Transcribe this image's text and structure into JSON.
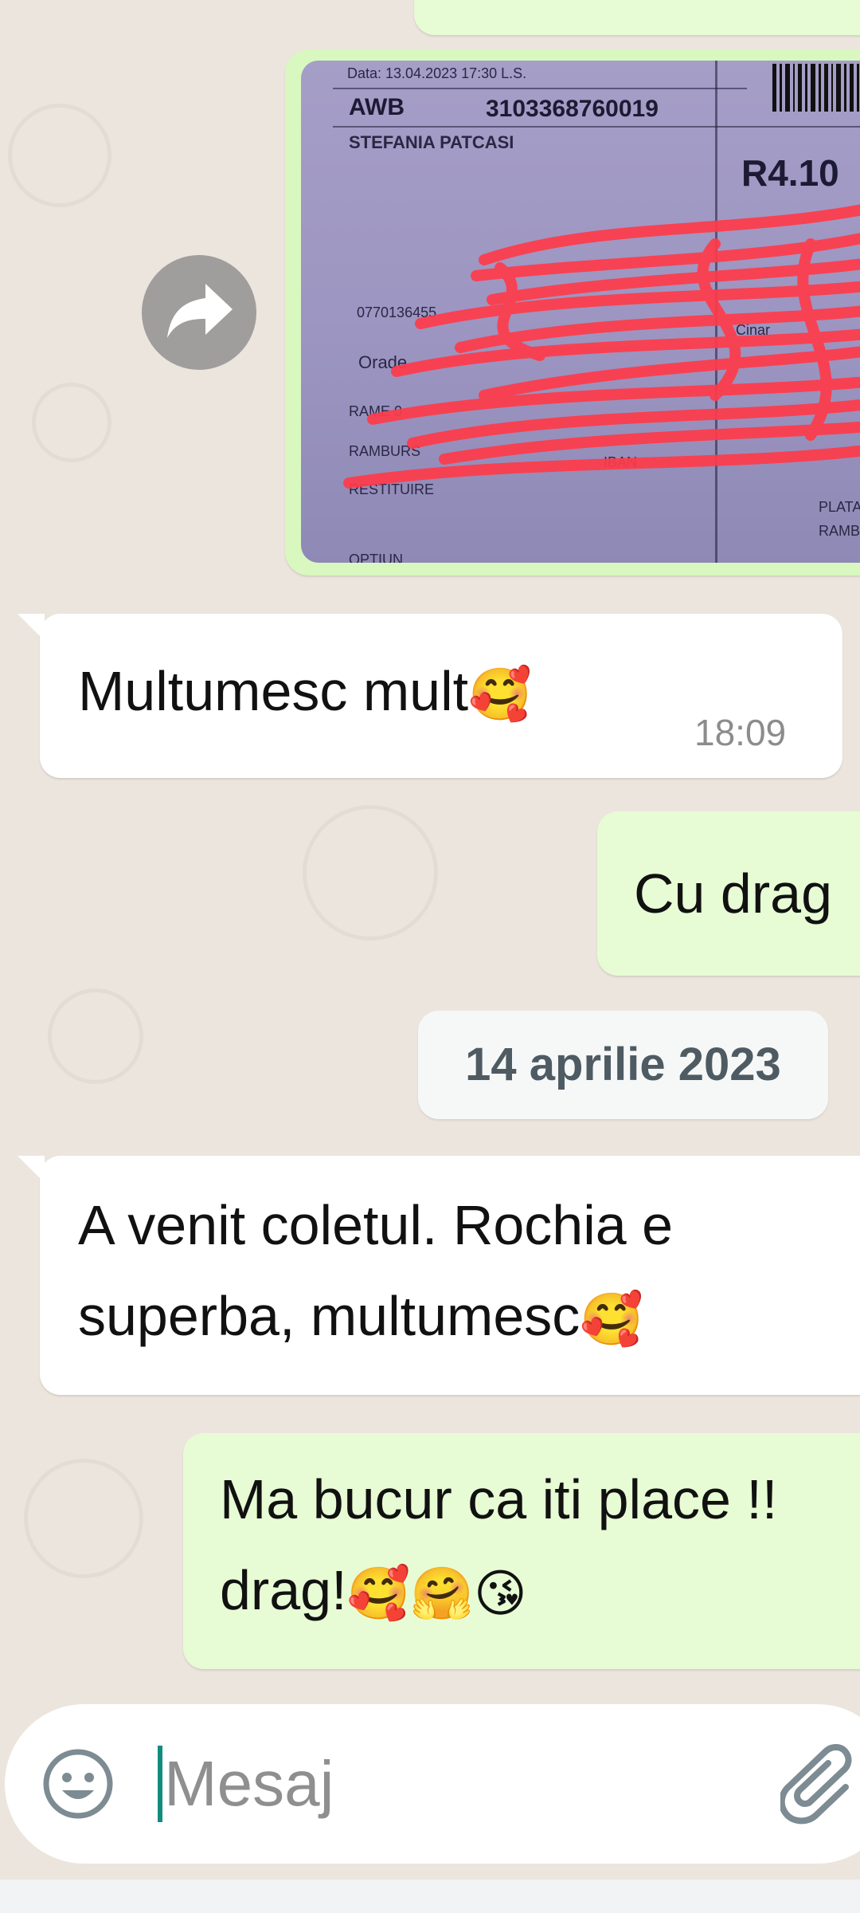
{
  "image_message": {
    "text_lines": [
      "Data: 13.04.2023  17:30  L.S.",
      "AWB",
      "3103368760019",
      "STEFANIA PATCASI",
      "R4.10",
      "0770136455",
      "Orade",
      "RAME  0",
      "RAMBURS",
      "IBAN",
      "RESTITUIRE",
      "Cinar",
      "PLATA",
      "RAMB",
      "OPTIUN"
    ]
  },
  "messages": [
    {
      "dir": "in",
      "text": "Multumesc mult",
      "emoji": "🥰",
      "time": "18:09"
    },
    {
      "dir": "out",
      "text": "Cu drag"
    },
    {
      "dir": "in",
      "line1": "A venit coletul. Rochia e",
      "line2": "superba, multumesc",
      "emoji": "🥰"
    },
    {
      "dir": "out",
      "line1": "Ma bucur ca iti place !!",
      "line2": "drag!",
      "emojis": "🥰🤗😘"
    }
  ],
  "date_divider": "14 aprilie 2023",
  "input": {
    "placeholder": "Mesaj"
  },
  "icons": {
    "forward": "forward-icon",
    "emoji": "emoji-icon",
    "attach": "attach-icon"
  },
  "colors": {
    "incoming": "#ffffff",
    "outgoing": "#e7fcd4",
    "background": "#ece5dd",
    "caret": "#128c7e",
    "redaction": "#ff3b4a"
  }
}
